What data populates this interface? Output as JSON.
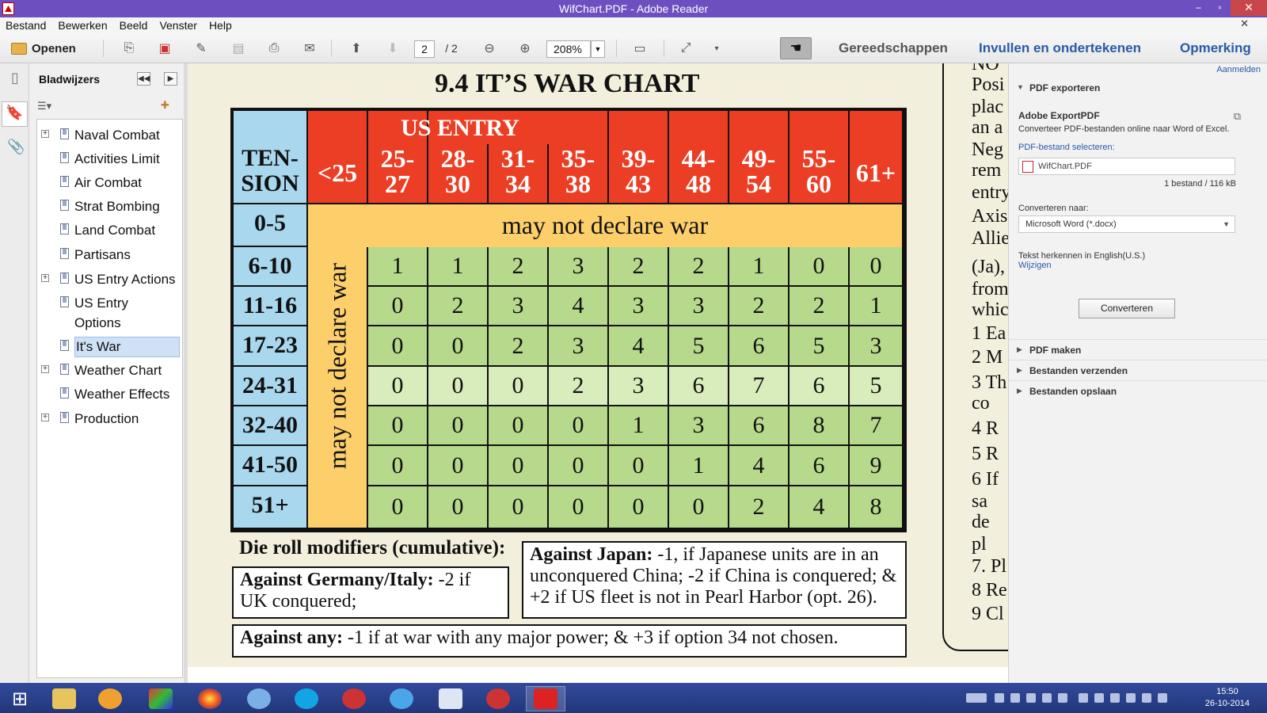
{
  "window": {
    "title": "WifChart.PDF - Adobe Reader",
    "min": "–",
    "restore": "▫",
    "close": "✕"
  },
  "menu": [
    "Bestand",
    "Bewerken",
    "Beeld",
    "Venster",
    "Help"
  ],
  "toolbar": {
    "open_label": "Openen",
    "page_current": "2",
    "page_total": "/ 2",
    "zoom": "208%",
    "tools": "Gereedschappen",
    "fill_sign": "Invullen en ondertekenen",
    "comment": "Opmerking"
  },
  "bookmarks": {
    "title": "Bladwijzers",
    "items": [
      {
        "label": "Naval Combat",
        "expandable": true
      },
      {
        "label": "Activities Limit",
        "expandable": false
      },
      {
        "label": "Air Combat",
        "expandable": false
      },
      {
        "label": "Strat Bombing",
        "expandable": false
      },
      {
        "label": "Land Combat",
        "expandable": false
      },
      {
        "label": "Partisans",
        "expandable": false
      },
      {
        "label": "US Entry Actions",
        "expandable": true
      },
      {
        "label": "US Entry",
        "expandable": false
      },
      {
        "label": "Options",
        "expandable": false
      },
      {
        "label": "It's War",
        "expandable": false,
        "selected": true
      },
      {
        "label": "Weather Chart",
        "expandable": true
      },
      {
        "label": "Weather Effects",
        "expandable": false
      },
      {
        "label": "Production",
        "expandable": true
      }
    ]
  },
  "document": {
    "title": "9.4   IT’S WAR CHART",
    "us_entry_label": "US ENTRY",
    "tension_label": [
      "TEN-",
      "SION"
    ],
    "col_headers": [
      [
        "<25"
      ],
      [
        "25-",
        "27"
      ],
      [
        "28-",
        "30"
      ],
      [
        "31-",
        "34"
      ],
      [
        "35-",
        "38"
      ],
      [
        "39-",
        "43"
      ],
      [
        "44-",
        "48"
      ],
      [
        "49-",
        "54"
      ],
      [
        "55-",
        "60"
      ],
      [
        "61+"
      ]
    ],
    "row_headers": [
      "0-5",
      "6-10",
      "11-16",
      "17-23",
      "24-31",
      "32-40",
      "41-50",
      "51+"
    ],
    "may_not_declare": "may not declare war",
    "grid": [
      [
        1,
        1,
        2,
        3,
        2,
        2,
        1,
        0,
        0
      ],
      [
        0,
        2,
        3,
        4,
        3,
        3,
        2,
        2,
        1
      ],
      [
        0,
        0,
        2,
        3,
        4,
        5,
        6,
        5,
        3
      ],
      [
        0,
        0,
        0,
        2,
        3,
        6,
        7,
        6,
        5
      ],
      [
        0,
        0,
        0,
        0,
        1,
        3,
        6,
        8,
        7
      ],
      [
        0,
        0,
        0,
        0,
        0,
        1,
        4,
        6,
        9
      ],
      [
        0,
        0,
        0,
        0,
        0,
        0,
        2,
        4,
        8
      ]
    ],
    "modifiers_heading": "Die roll modifiers (cumulative):",
    "germany_bold": "Against Germany/Italy:",
    "germany_text": "-2 if UK conquered;",
    "japan_bold": "Against Japan:",
    "japan_text": "-1, if Japanese units are in an unconquered China; -2 if China is conquered; & +2 if US fleet is not in Pearl Harbor (opt. 26).",
    "any_bold": "Against any:",
    "any_text": "-1 if at war with any major power; & +3 if option 34 not chosen.",
    "right_page_lines": [
      "NO",
      "Posi",
      "plac",
      "an a",
      "Neg",
      "rem",
      "entry",
      "Axis",
      "Allie",
      "(Ja),",
      "from",
      "whic",
      "1  Ea",
      "2  M",
      "3 Th",
      "    co",
      "4  R",
      "5  R",
      "6  If",
      "    sa",
      "    de",
      "    pl",
      "7. Pl",
      "8  Re",
      "9  Cl"
    ]
  },
  "right_pane": {
    "sign_in": "Aanmelden",
    "export_title": "PDF exporteren",
    "service": "Adobe ExportPDF",
    "service_desc": "Converteer PDF-bestanden online naar Word of Excel.",
    "select_label": "PDF-bestand selecteren:",
    "file_name": "WifChart.PDF",
    "file_count": "1 bestand / 116 kB",
    "convert_to": "Converteren naar:",
    "format": "Microsoft Word (*.docx)",
    "ocr": "Tekst herkennen in English(U.S.)",
    "change": "Wijzigen",
    "convert_button": "Converteren",
    "sections": [
      "PDF maken",
      "Bestanden verzenden",
      "Bestanden opslaan"
    ]
  },
  "taskbar": {
    "time": "15:50",
    "date": "26-10-2014"
  }
}
